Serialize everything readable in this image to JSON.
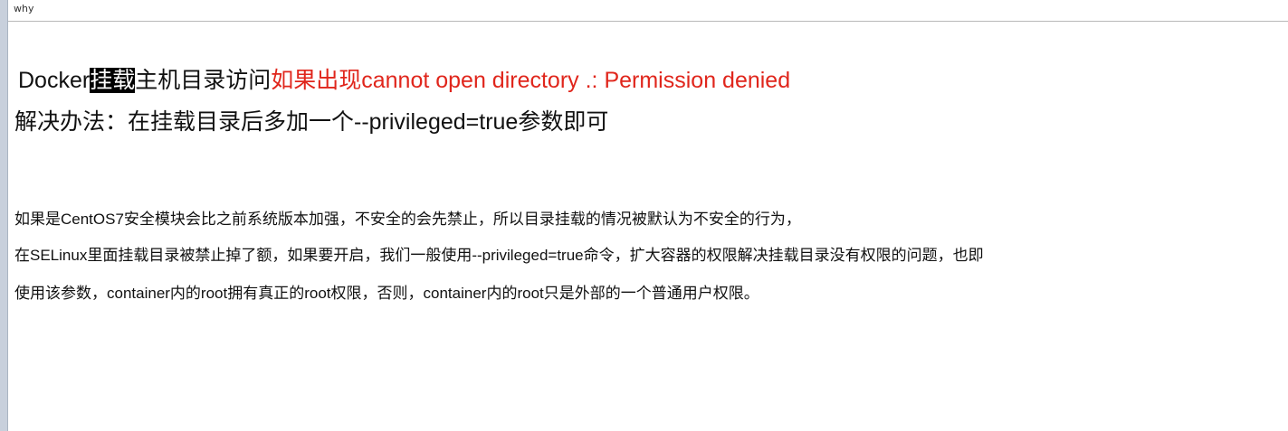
{
  "window": {
    "title": "why"
  },
  "heading": {
    "prefix": "Docker",
    "highlighted": "挂载",
    "after_highlight": "主机目录访问",
    "error_lead": "如果出现",
    "error_message": "cannot open directory .: Permission denied"
  },
  "solution": {
    "text": "解决办法：在挂载目录后多加一个--privileged=true参数即可"
  },
  "explanation": {
    "lines": [
      "如果是CentOS7安全模块会比之前系统版本加强，不安全的会先禁止，所以目录挂载的情况被默认为不安全的行为，",
      "在SELinux里面挂载目录被禁止掉了额，如果要开启，我们一般使用--privileged=true命令，扩大容器的权限解决挂载目录没有权限的问题，也即",
      "使用该参数，container内的root拥有真正的root权限，否则，container内的root只是外部的一个普通用户权限。"
    ]
  },
  "colors": {
    "error_text": "#e0261c",
    "selection_background": "#000000",
    "selection_text": "#ffffff"
  },
  "icons": {
    "cursor": "mouse-pointer-icon"
  }
}
